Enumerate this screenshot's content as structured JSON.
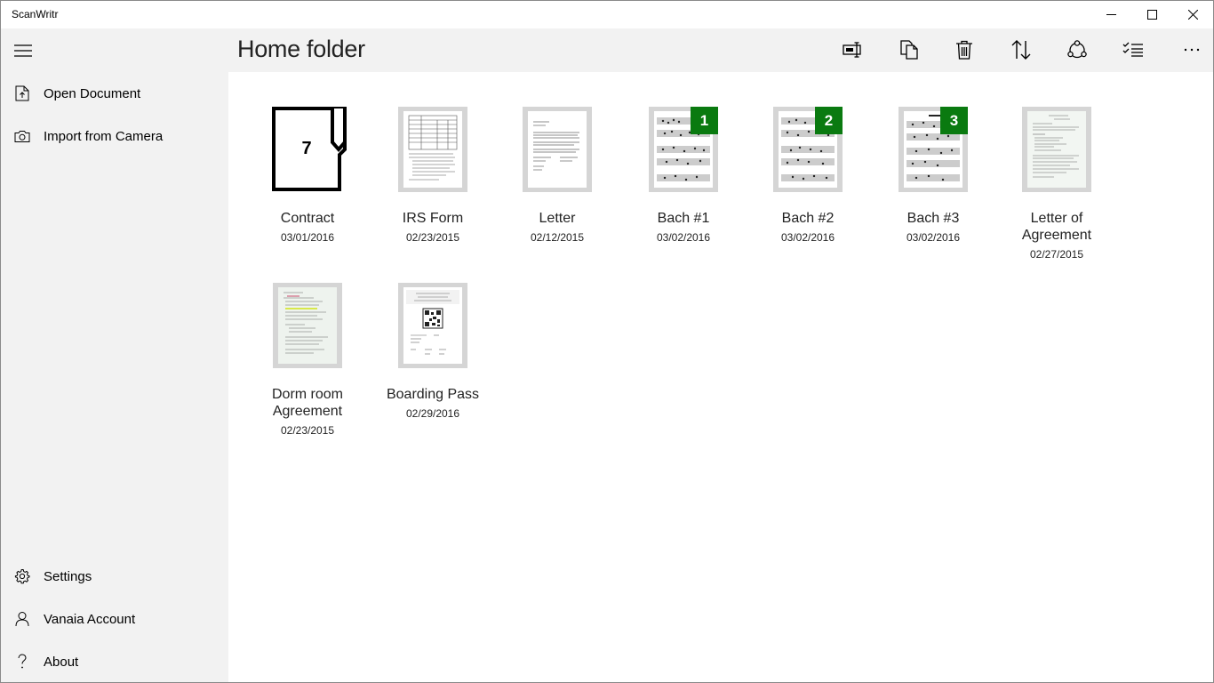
{
  "app": {
    "title": "ScanWritr"
  },
  "window_controls": {
    "minimize_icon": "minimize-icon",
    "maximize_icon": "maximize-icon",
    "close_icon": "close-icon"
  },
  "sidebar": {
    "menu_icon": "hamburger-icon",
    "top_items": [
      {
        "label": "Open Document",
        "icon": "document-open-icon"
      },
      {
        "label": "Import from Camera",
        "icon": "camera-icon"
      }
    ],
    "bottom_items": [
      {
        "label": "Settings",
        "icon": "gear-icon"
      },
      {
        "label": "Vanaia Account",
        "icon": "person-icon"
      },
      {
        "label": "About",
        "icon": "question-icon"
      }
    ]
  },
  "header": {
    "title": "Home folder",
    "toolbar": [
      "rename-icon",
      "copy-icon",
      "delete-icon",
      "sort-icon",
      "share-icon",
      "select-icon",
      "more-icon"
    ]
  },
  "documents": [
    {
      "name": "Contract",
      "date": "03/01/2016",
      "kind": "folder",
      "count": "7"
    },
    {
      "name": "IRS Form",
      "date": "02/23/2015",
      "kind": "form"
    },
    {
      "name": "Letter",
      "date": "02/12/2015",
      "kind": "letter"
    },
    {
      "name": "Bach #1",
      "date": "03/02/2016",
      "kind": "music",
      "badge": "1"
    },
    {
      "name": "Bach #2",
      "date": "03/02/2016",
      "kind": "music",
      "badge": "2"
    },
    {
      "name": "Bach #3",
      "date": "03/02/2016",
      "kind": "music",
      "badge": "3"
    },
    {
      "name": "Letter of Agreement",
      "date": "02/27/2015",
      "kind": "agreement"
    },
    {
      "name": "Dorm room Agreement",
      "date": "02/23/2015",
      "kind": "dorm"
    },
    {
      "name": "Boarding Pass",
      "date": "02/29/2016",
      "kind": "boarding"
    }
  ],
  "colors": {
    "badge": "#0a7a10",
    "sidebar_bg": "#f2f2f2",
    "thumb_frame": "#d5d5d5"
  }
}
